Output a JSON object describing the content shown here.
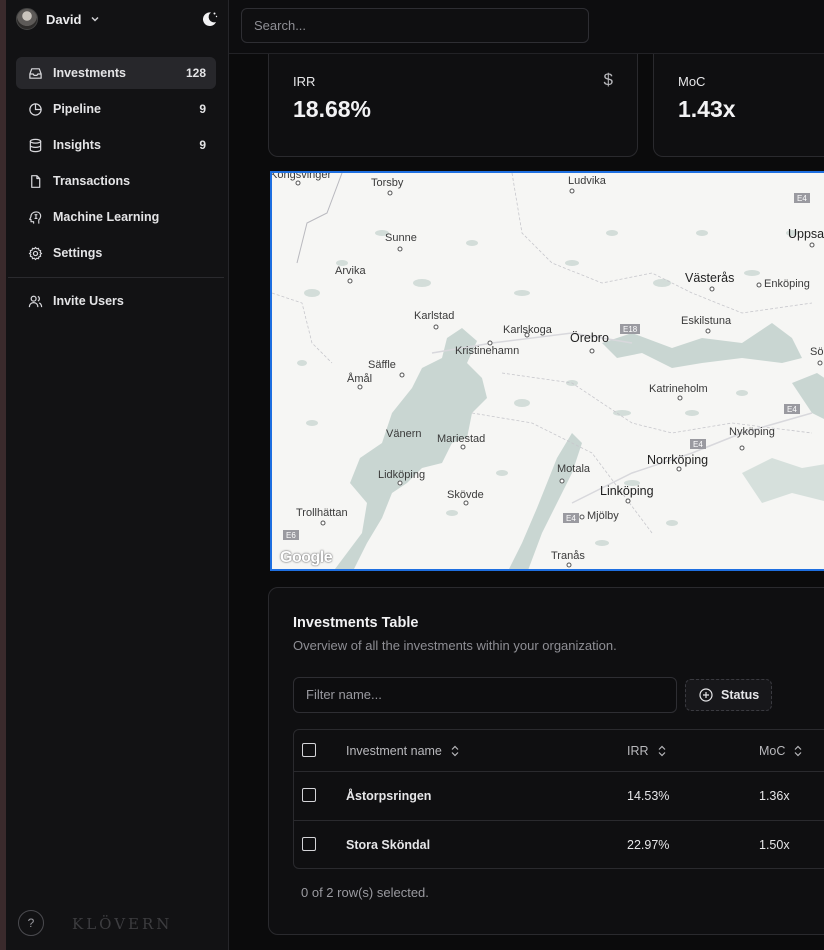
{
  "user": {
    "name": "David"
  },
  "nav": {
    "items": [
      {
        "label": "Investments",
        "count": "128",
        "icon": "inbox-icon"
      },
      {
        "label": "Pipeline",
        "count": "9",
        "icon": "pie-chart-icon"
      },
      {
        "label": "Insights",
        "count": "9",
        "icon": "database-icon"
      },
      {
        "label": "Transactions",
        "count": "",
        "icon": "file-icon"
      },
      {
        "label": "Machine Learning",
        "count": "",
        "icon": "brain-icon"
      },
      {
        "label": "Settings",
        "count": "",
        "icon": "gear-icon"
      }
    ],
    "invite_label": "Invite Users"
  },
  "footer": {
    "help": "?",
    "logo": "KLÖVERN"
  },
  "search": {
    "placeholder": "Search..."
  },
  "stats": {
    "irr": {
      "label": "IRR",
      "value": "18.68%",
      "icon": "$"
    },
    "moc": {
      "label": "MoC",
      "value": "1.43x"
    }
  },
  "map": {
    "attribution": "Google",
    "places": [
      {
        "name": "Kongsvinger"
      },
      {
        "name": "Torsby"
      },
      {
        "name": "Ludvika"
      },
      {
        "name": "Sunne"
      },
      {
        "name": "Arvika"
      },
      {
        "name": "Västerås"
      },
      {
        "name": "Enköping"
      },
      {
        "name": "Uppsa"
      },
      {
        "name": "Karlstad"
      },
      {
        "name": "Karlskoga"
      },
      {
        "name": "Eskilstuna"
      },
      {
        "name": "Örebro"
      },
      {
        "name": "Kristinehamn"
      },
      {
        "name": "Säffle"
      },
      {
        "name": "Åmål"
      },
      {
        "name": "Södertä"
      },
      {
        "name": "Katrineholm"
      },
      {
        "name": "Vänern"
      },
      {
        "name": "Mariestad"
      },
      {
        "name": "Nyköping"
      },
      {
        "name": "Norrköping"
      },
      {
        "name": "Lidköping"
      },
      {
        "name": "Motala"
      },
      {
        "name": "Linköping"
      },
      {
        "name": "Skövde"
      },
      {
        "name": "Trollhättan"
      },
      {
        "name": "Mjölby"
      },
      {
        "name": "Tranås"
      }
    ],
    "road_labels": [
      "E4",
      "E18",
      "E4",
      "E4",
      "E4",
      "E6"
    ]
  },
  "table": {
    "title": "Investments Table",
    "subtitle": "Overview of all the investments within your organization.",
    "filter_placeholder": "Filter name...",
    "status_label": "Status",
    "columns": [
      "Investment name",
      "IRR",
      "MoC"
    ],
    "rows": [
      {
        "name": "Åstorpsringen",
        "irr": "14.53%",
        "moc": "1.36x"
      },
      {
        "name": "Stora Sköndal",
        "irr": "22.97%",
        "moc": "1.50x"
      }
    ],
    "selection_text": "0 of 2 row(s) selected."
  }
}
